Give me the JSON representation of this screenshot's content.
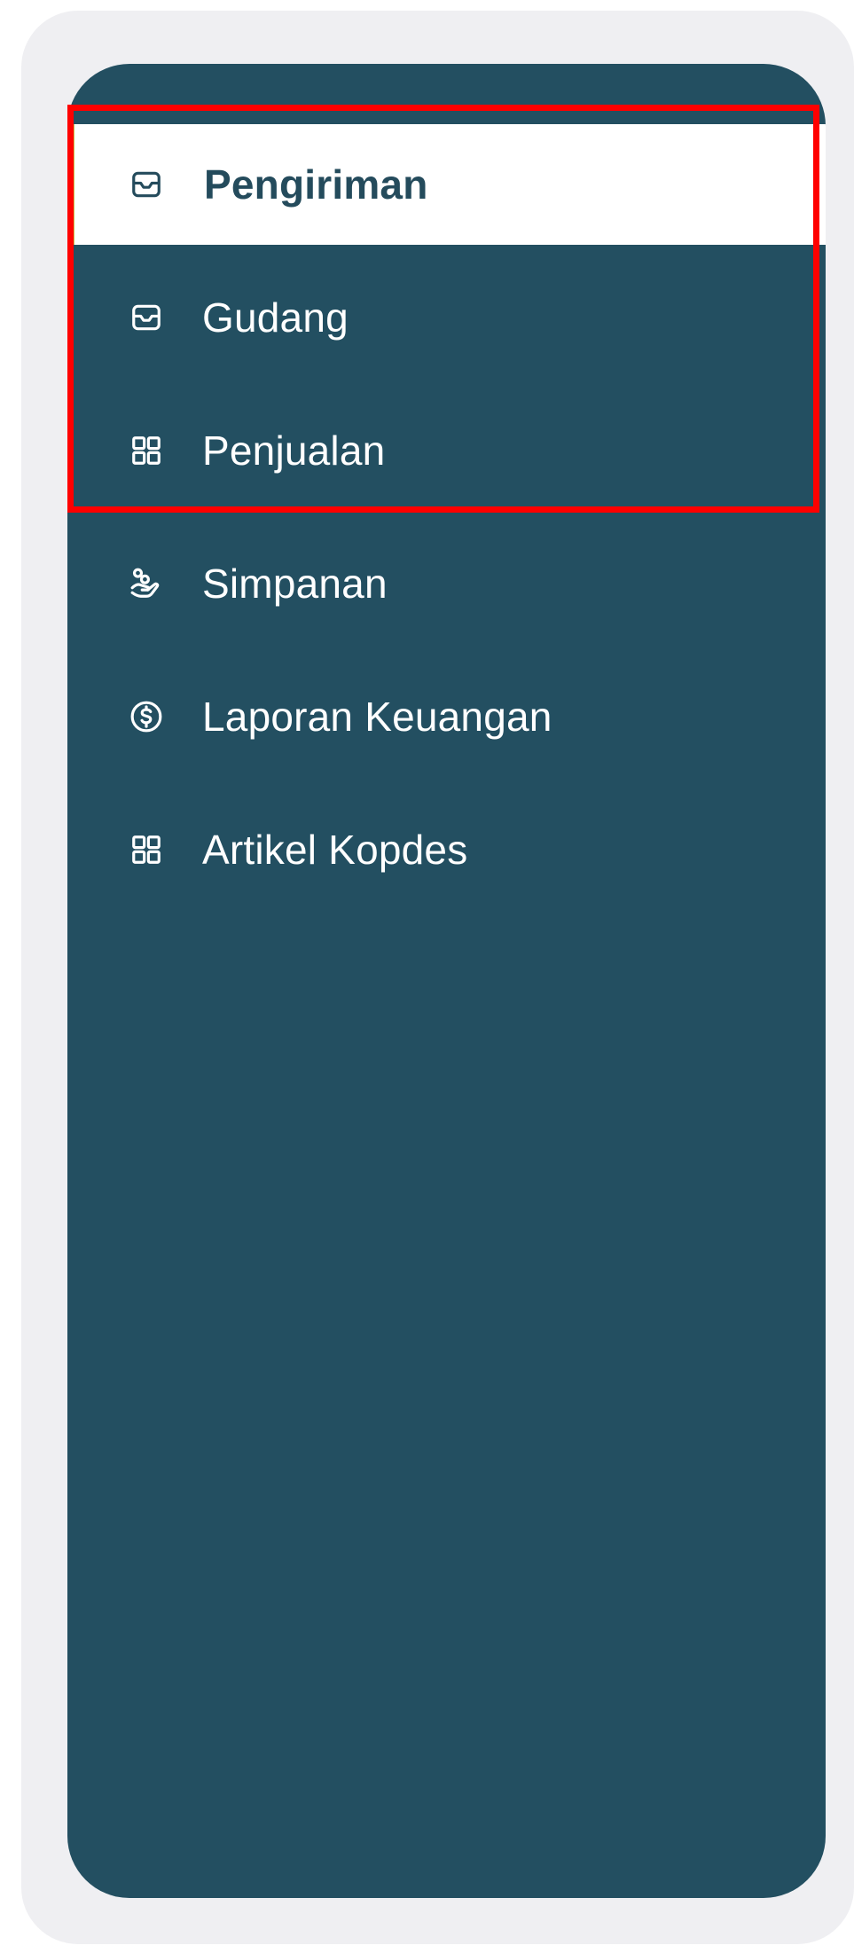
{
  "sidebar": {
    "items": [
      {
        "label": "Pengiriman",
        "icon": "inbox-icon",
        "active": true
      },
      {
        "label": "Gudang",
        "icon": "inbox-icon",
        "active": false
      },
      {
        "label": "Penjualan",
        "icon": "grid-icon",
        "active": false
      },
      {
        "label": "Simpanan",
        "icon": "hand-coins-icon",
        "active": false
      },
      {
        "label": "Laporan Keuangan",
        "icon": "dollar-circle-icon",
        "active": false
      },
      {
        "label": "Artikel Kopdes",
        "icon": "grid-icon",
        "active": false
      }
    ]
  },
  "colors": {
    "sidebar_bg": "#234f61",
    "active_bg": "#ffffff",
    "active_text": "#244b5c",
    "active_accent": "#c8c24a",
    "highlight": "#ff0000",
    "outer_bg": "#efeff2"
  }
}
